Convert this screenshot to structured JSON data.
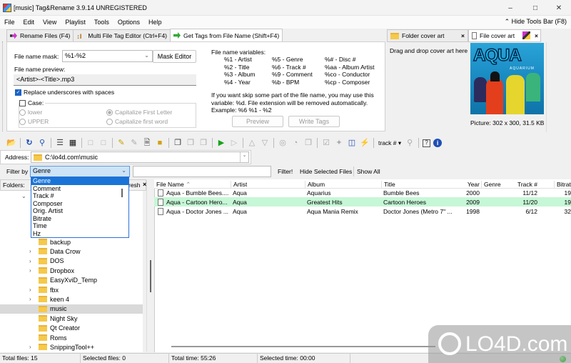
{
  "window": {
    "title": "[music] Tag&Rename 3.9.14 UNREGISTERED",
    "controls": [
      "minimize",
      "maximize",
      "close"
    ]
  },
  "menu": {
    "items": [
      "File",
      "Edit",
      "View",
      "Playlist",
      "Tools",
      "Options",
      "Help"
    ],
    "hide_tools": "Hide Tools Bar (F8)"
  },
  "tabs": [
    {
      "label": "Rename Files (F4)",
      "icon": "rename-icon",
      "active": false
    },
    {
      "label": "Multi File Tag Editor (Ctrl+F4)",
      "icon": "tag-editor-icon",
      "active": false
    },
    {
      "label": "Get Tags from File Name (Shift+F4)",
      "icon": "get-tags-icon",
      "active": true
    }
  ],
  "tools": {
    "mask_label": "File name mask:",
    "mask_value": "%1-%2",
    "mask_editor": "Mask Editor",
    "preview_label": "File name preview:",
    "preview_value": "<Artist>-<Title>.mp3",
    "replace_underscores": "Replace underscores with spaces",
    "replace_checked": true,
    "case_label": "Case:",
    "case_checked": false,
    "case_options": [
      "lower",
      "UPPER",
      "Capitalize First Letter",
      "Capitalize first word"
    ],
    "case_selected": "Capitalize First Letter",
    "vars_title": "File name variables:",
    "vars": [
      [
        "%1 - Artist",
        "%2 - Title",
        "%3 - Album",
        "%4 - Year"
      ],
      [
        "%5 - Genre",
        "%6 - Track #",
        "%9 - Comment",
        "%b - BPM"
      ],
      [
        "%# - Disc #",
        "%aa - Album Artist",
        "%co - Conductor",
        "%cp - Composer"
      ]
    ],
    "hint_line1": "If you want skip some part of the file name, you may use this",
    "hint_line2": "variable: %d. File extension will be removed automatically.",
    "hint_line3": "Example: %6 %1 - %2",
    "preview_btn": "Preview",
    "write_tags_btn": "Write Tags"
  },
  "cover": {
    "folder_tab": "Folder cover art",
    "file_tab": "File cover art",
    "drop_hint": "Drag and drop cover art here",
    "picture_info": "Picture: 302 x 300, 31.5 KB",
    "album_logo": "AQUA",
    "album_sub": "AQUARIUM"
  },
  "toolbar": {
    "sort_label": "track #"
  },
  "address": {
    "label": "Address:",
    "value": "C:\\lo4d.com\\music"
  },
  "filter": {
    "label": "Filter by",
    "selected": "Genre",
    "filter_btn": "Filter!",
    "hide_btn": "Hide Selected Files",
    "show_all_btn": "Show All",
    "options": [
      "Genre",
      "Comment",
      "Track #",
      "Composer",
      "Orig. Artist",
      "Bitrate",
      "Time",
      "Hz"
    ]
  },
  "folders": {
    "label": "Folders:",
    "refresh": "resh",
    "items": [
      {
        "name": "backup",
        "expandable": false,
        "selected": false
      },
      {
        "name": "Data Crow",
        "expandable": true,
        "selected": false
      },
      {
        "name": "DOS",
        "expandable": true,
        "selected": false
      },
      {
        "name": "Dropbox",
        "expandable": true,
        "selected": false
      },
      {
        "name": "EasyXviD_Temp",
        "expandable": false,
        "selected": false
      },
      {
        "name": "fbx",
        "expandable": true,
        "selected": false
      },
      {
        "name": "keen 4",
        "expandable": true,
        "selected": false
      },
      {
        "name": "music",
        "expandable": false,
        "selected": true
      },
      {
        "name": "Night Sky",
        "expandable": false,
        "selected": false
      },
      {
        "name": "Qt Creator",
        "expandable": false,
        "selected": false
      },
      {
        "name": "Roms",
        "expandable": false,
        "selected": false
      },
      {
        "name": "SnippingTool++",
        "expandable": true,
        "selected": false
      }
    ]
  },
  "files": {
    "columns": [
      "File Name",
      "Artist",
      "Album",
      "Title",
      "Year",
      "Genre",
      "Track #",
      "Bitrat"
    ],
    "rows": [
      {
        "file": "Aqua - Bumble Bees....",
        "artist": "Aqua",
        "album": "Aquarius",
        "title": "Bumble Bees",
        "year": "2000",
        "genre": "",
        "track": "11/12",
        "bitrate": "19",
        "highlight": false
      },
      {
        "file": "Aqua - Cartoon Hero...",
        "artist": "Aqua",
        "album": "Greatest Hits",
        "title": "Cartoon Heroes",
        "year": "2009",
        "genre": "",
        "track": "11/20",
        "bitrate": "19",
        "highlight": true
      },
      {
        "file": "Aqua - Doctor Jones ...",
        "artist": "Aqua",
        "album": "Aqua Mania Remix",
        "title": "Doctor Jones (Metro 7\" ...",
        "year": "1998",
        "genre": "",
        "track": "6/12",
        "bitrate": "32",
        "highlight": false
      }
    ]
  },
  "status": {
    "total_files": "Total files: 15",
    "selected_files": "Selected files: 0",
    "total_time": "Total time: 55:26",
    "selected_time": "Selected time: 00:00"
  },
  "watermark": "LO4D.com"
}
